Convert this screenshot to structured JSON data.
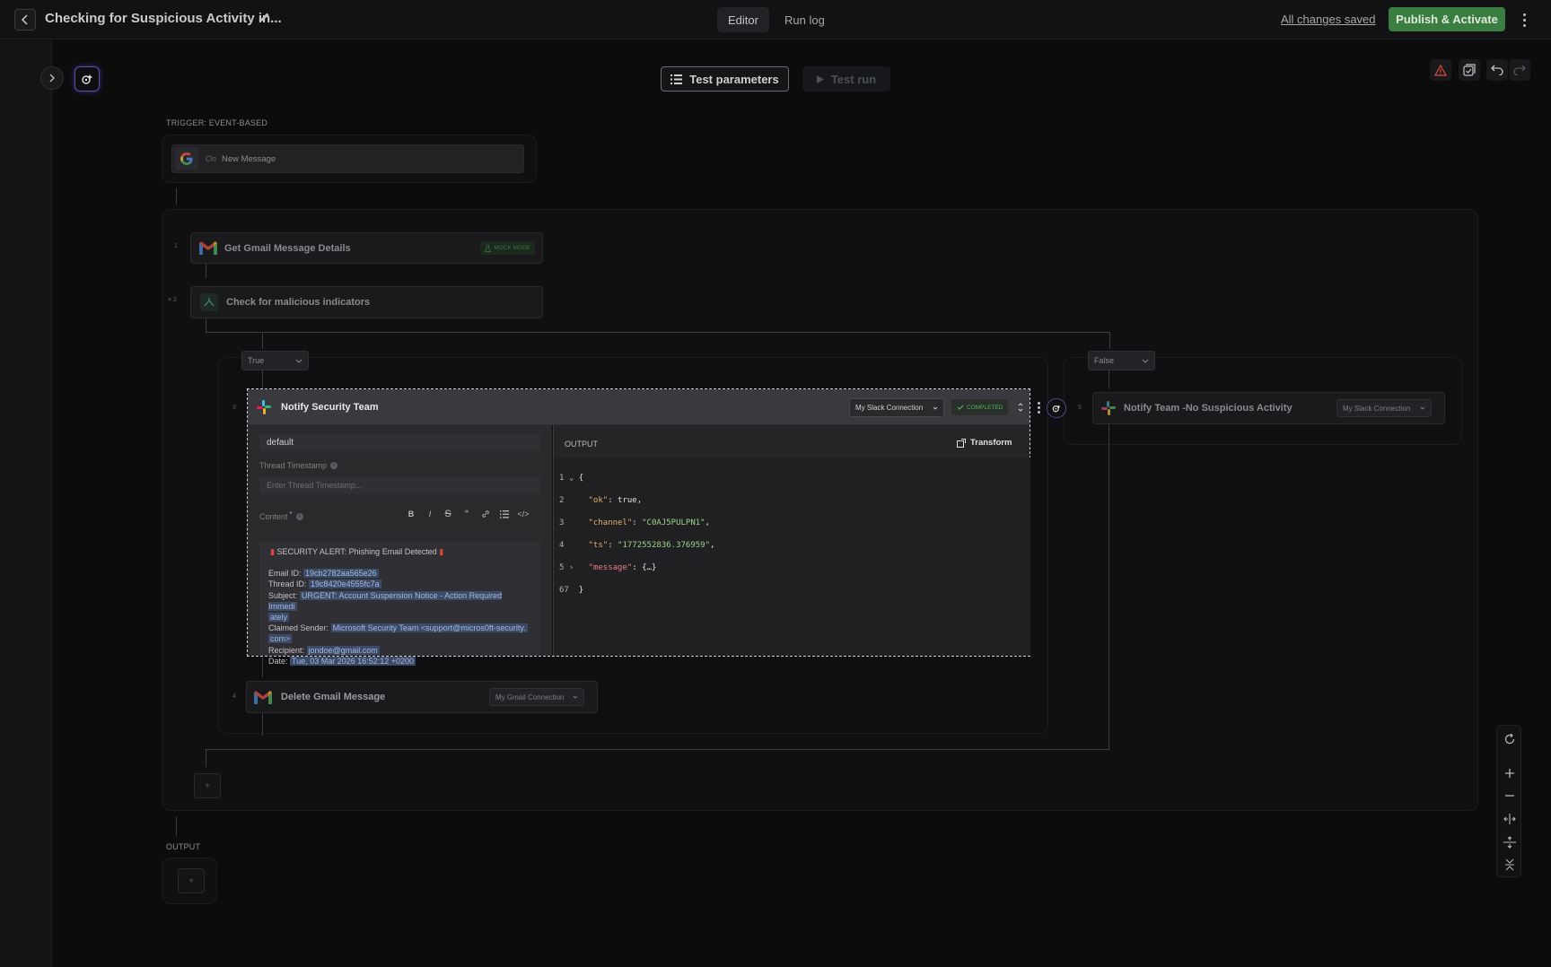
{
  "header": {
    "workflow_title": "Checking for Suspicious Activity in...",
    "tabs": [
      {
        "label": "Editor"
      },
      {
        "label": "Run log"
      }
    ],
    "saved_status": "All changes saved",
    "publish_label": "Publish & Activate"
  },
  "toolbar": {
    "test_parameters_label": "Test parameters",
    "test_run_label": "Test run"
  },
  "trigger": {
    "section_label": "TRIGGER: EVENT-BASED",
    "on_label": "On",
    "event_label": "New Message"
  },
  "steps": {
    "step1": {
      "number": "1",
      "title": "Get Gmail Message Details",
      "badge": "MOCK MODE"
    },
    "step2": {
      "number": "2",
      "title": "Check for malicious indicators"
    },
    "true_branch_label": "True",
    "false_branch_label": "False",
    "step3": {
      "number": "3",
      "title": "Notify Security Team",
      "connection": "My Slack Connection",
      "status": "COMPLETED"
    },
    "step4": {
      "number": "4",
      "title": "Delete Gmail Message",
      "connection": "My Gmail Connection"
    },
    "step5": {
      "number": "5",
      "title": "Notify Team -No Suspicious Activity",
      "connection": "My Slack Connection"
    }
  },
  "form": {
    "channel_value": "default",
    "thread_label": "Thread Timestamp",
    "thread_placeholder": "Enter Thread Timestamp...",
    "content_label": "Content",
    "required_mark": "*",
    "content": {
      "headline": "SECURITY ALERT: Phishing Email Detected",
      "email_id_label": "Email ID:",
      "email_id": "19cb2782aa565e26",
      "thread_id_label": "Thread ID:",
      "thread_id": "19c8420e4555fc7a",
      "subject_label": "Subject:",
      "subject_line1": "URGENT: Account Suspension Notice - Action Required Immedi",
      "subject_line2": "ately",
      "sender_label": "Claimed Sender:",
      "sender_line1": "Microsoft Security Team <support@micros0ft-security.",
      "sender_line2": "com>",
      "recipient_label": "Recipient:",
      "recipient": "jondoe@gmail.com",
      "date_label": "Date:",
      "date": "Tue, 03 Mar 2026 16:52:12 +0200"
    }
  },
  "output": {
    "label": "OUTPUT",
    "transform_label": "Transform",
    "lines": {
      "l1": {
        "num": "1",
        "text": "{"
      },
      "l2": {
        "num": "2",
        "key": "\"ok\"",
        "value": "true,"
      },
      "l3": {
        "num": "3",
        "key": "\"channel\"",
        "value": "\"C0AJ5PULPN1\"",
        "end": ","
      },
      "l4": {
        "num": "4",
        "key": "\"ts\"",
        "value": "\"1772552836.376959\"",
        "end": ","
      },
      "l5": {
        "num": "5",
        "key": "\"message\"",
        "value": "{…}"
      },
      "l6": {
        "num": "67",
        "text": "}"
      }
    }
  },
  "final_output_label": "OUTPUT",
  "add_symbol": "+",
  "colors": {
    "accent_green": "#3a7d40",
    "completed_green": "#4fb35d",
    "highlight_blue": "#3b4a66"
  }
}
